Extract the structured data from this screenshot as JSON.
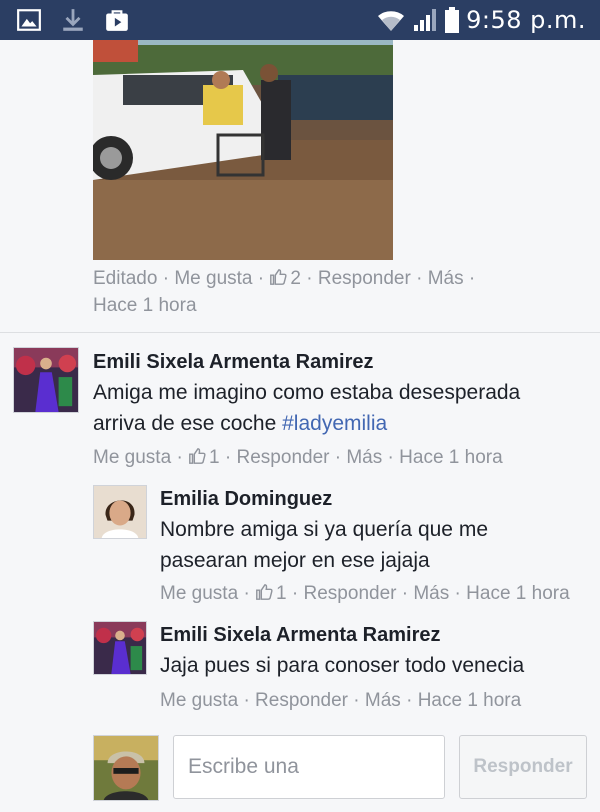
{
  "status_bar": {
    "time": "9:58 p.m.",
    "left_icons": [
      "image-icon",
      "download-icon",
      "shopping-bag-icon"
    ],
    "right_icons": [
      "wifi-icon",
      "signal-icon",
      "battery-icon"
    ]
  },
  "post": {
    "photo_icon": "photo-flooded-street-car",
    "meta": {
      "edited": "Editado",
      "like": "Me gusta",
      "likes_count": "2",
      "reply": "Responder",
      "more": "Más",
      "time": "Hace 1 hora"
    }
  },
  "comments": [
    {
      "author": "Emili Sixela Armenta Ramirez",
      "text_line1": "Amiga me imagino como estaba desesperada",
      "text_line2": "arriva de ese coche",
      "hashtag": "#ladyemilia",
      "like": "Me gusta",
      "likes_count": "1",
      "reply": "Responder",
      "more": "Más",
      "time": "Hace 1 hora",
      "replies": [
        {
          "author": "Emilia Dominguez",
          "text_line1": "Nombre amiga si ya quería que me",
          "text_line2": "pasearan mejor en ese jajaja",
          "like": "Me gusta",
          "likes_count": "1",
          "reply": "Responder",
          "more": "Más",
          "time": "Hace 1 hora"
        },
        {
          "author": "Emili Sixela Armenta Ramirez",
          "text_line1": "Jaja pues si para conoser todo venecia",
          "like": "Me gusta",
          "reply": "Responder",
          "more": "Más",
          "time": "Hace 1 hora"
        }
      ]
    }
  ],
  "composer": {
    "placeholder": "Escribe una",
    "button_label": "Responder"
  },
  "colors": {
    "status_bar": "#2b3e63",
    "link": "#4267b2",
    "meta_text": "#90949c",
    "background": "#f6f7f9"
  }
}
